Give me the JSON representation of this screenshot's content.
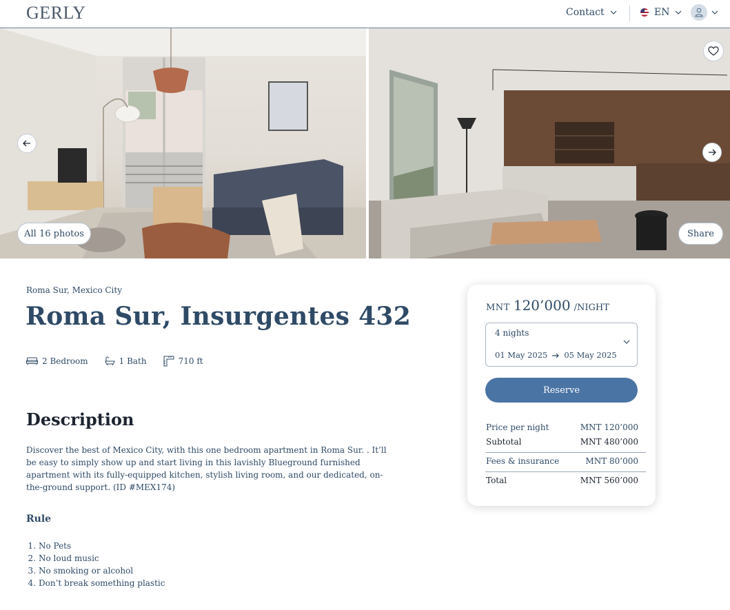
{
  "header": {
    "logo": "GERLY",
    "contact_label": "Contact",
    "language_label": "EN"
  },
  "gallery": {
    "all_photos_label": "All 16 photos",
    "share_label": "Share"
  },
  "listing": {
    "location": "Roma Sur, Mexico City",
    "title": "Roma Sur, Insurgentes 432",
    "features": {
      "bedrooms": "2 Bedroom",
      "baths": "1 Bath",
      "area": "710 ft"
    },
    "description_heading": "Description",
    "description": "Discover the best of Mexico City, with this one bedroom apartment in Roma Sur. . It’ll be easy to simply show up and start living in this lavishly Blueground furnished apartment with its fully-equipped kitchen, stylish living room, and our dedicated, on-the-ground support. (ID #MEX174)",
    "rule_heading": "Rule",
    "rules": [
      "No Pets",
      "No loud music",
      "No smoking or alcohol",
      "Don’t break something plastic"
    ]
  },
  "booking": {
    "currency": "MNT",
    "price": "120’000",
    "per_night": "/NIGHT",
    "nights": "4 nights",
    "date_from": "01 May 2025",
    "date_to": "05 May 2025",
    "reserve_label": "Reserve",
    "price_per_night_label": "Price per night",
    "price_per_night_value": "MNT 120’000",
    "subtotal_label": "Subtotal",
    "subtotal_value": "MNT 480’000",
    "fees_label": "Fees & insurance",
    "fees_value": "MNT 80’000",
    "total_label": "Total",
    "total_value": "MNT 560’000"
  },
  "colors": {
    "accent": "#4a74a4",
    "text": "#2e4a66"
  },
  "icons": [
    "chevron-down-icon",
    "flag-us-icon",
    "user-icon",
    "heart-icon",
    "arrow-left-icon",
    "arrow-right-icon",
    "bed-icon",
    "bath-icon",
    "area-icon"
  ]
}
